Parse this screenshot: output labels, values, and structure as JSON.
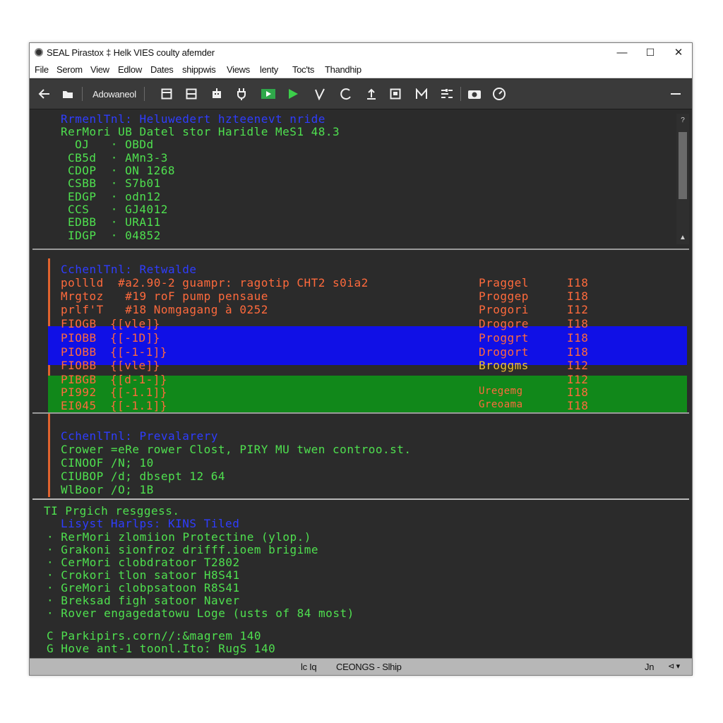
{
  "window": {
    "title": "SEAL Pirastox ‡ Helk VIES coulty afemder",
    "controls": {
      "minimize": "—",
      "maximize": "☐",
      "close": "✕"
    }
  },
  "menubar": {
    "items": [
      "File",
      "Serom",
      "View",
      "Edlow",
      "Dates",
      "shippwis",
      "Views",
      "lenty",
      "Toc'ts",
      "Thandhip"
    ]
  },
  "toolbar": {
    "advanced_label": "Adowaneol",
    "icons": [
      "back-arrow-icon",
      "folder-icon",
      "panel-icon",
      "split-view-icon",
      "robot-icon",
      "plug-icon",
      "monitor-play-icon",
      "run-icon",
      "check-icon",
      "refresh-icon",
      "upload-icon",
      "save-icon",
      "mail-icon",
      "settings-list-icon",
      "camera-icon",
      "gauge-icon",
      "menu-dash-icon"
    ]
  },
  "pane1": {
    "header": "RrmenlTnl: Heluwedert hzteenevt nride",
    "subheader": "RerMori UB Datel stor Haridle MeS1 48.3",
    "rows": [
      {
        "key": " OJ ",
        "value": "OBDd"
      },
      {
        "key": "CB5d",
        "value": "AMn3-3"
      },
      {
        "key": "CDOP",
        "value": "ON 1268"
      },
      {
        "key": "CSBB",
        "value": "S7b01"
      },
      {
        "key": "EDGP",
        "value": "odn12"
      },
      {
        "key": "CCS ",
        "value": "GJ4012"
      },
      {
        "key": "EDBB",
        "value": "URA11"
      },
      {
        "key": "IDGP",
        "value": "04852"
      }
    ]
  },
  "pane2": {
    "header": "CchenlTnl: Retwalde",
    "lines": [
      "pollld  #a2.90-2 guampr: ragotip CHT2 s0ia2",
      "Mrgtoz   #19 roF pump pensaue",
      "prlf'T   #18 Nomgagang à 0252"
    ],
    "line_tags": [
      {
        "tag": "Praggel",
        "code": "I18"
      },
      {
        "tag": "Proggep",
        "code": "I18"
      },
      {
        "tag": "Progori",
        "code": "I12"
      }
    ],
    "rows": [
      {
        "id": "FIOGB",
        "field": "{[vle]}",
        "tag": "Drogore",
        "code": "I18",
        "highlight": "none"
      },
      {
        "id": "PIOBB",
        "field": "{[-1D]}",
        "tag": "Proggrt",
        "code": "I18",
        "highlight": "blue"
      },
      {
        "id": "PIOBB",
        "field": "{[-1-1]}",
        "tag": "Drogort",
        "code": "I18",
        "highlight": "blue"
      },
      {
        "id": "FIOBB",
        "field": "{[vle]}",
        "tag": "Broggms",
        "code": "I12",
        "highlight": "none"
      },
      {
        "id": "PIBGB",
        "field": "{[d-1-]}",
        "tag": "",
        "code": "I12",
        "highlight": "green"
      },
      {
        "id": "PI992",
        "field": "{[-1.1]}",
        "tag": "Uregemg",
        "code": "I18",
        "highlight": "green"
      },
      {
        "id": "EI045",
        "field": "{[-1.1]}",
        "tag": "Greoama",
        "code": "I18",
        "highlight": "green"
      }
    ]
  },
  "pane3": {
    "header": "CchenlTnl: Prevalarery",
    "lines": [
      "Crower =eRe rower Clost, PIRY MU twen controo.st.",
      "CINOOF /N; 10",
      "CIUBOP /d; dbsept 12 64",
      "WlBoor /O; 1B"
    ]
  },
  "pane4": {
    "prompt": "TI Prgich resggess.",
    "header": "Lisyst Harlps: KINS Tiled",
    "bullets": [
      "RerMori zlomiion Protectine (ylop.)",
      "Grakoni sionfroz drifff.ioem brigime",
      "CerMori clobdratoor T2802",
      "Crokori tlon satoor H8S41",
      "GreMori clobpsatoon R8S41",
      "Breksad figh satoor Naver",
      "Rover engagedatowu Loge (usts of 84 most)"
    ],
    "footer_lines": [
      "C Parkipirs.corn//:&magrem 140",
      "G Hove ant-1 toonl.Ito: RugS 140"
    ]
  },
  "statusbar": {
    "left": "lc Iq",
    "center": "CEONGS - Slhip",
    "right_code": "Jn",
    "right_icons": "⊲ ▾"
  }
}
